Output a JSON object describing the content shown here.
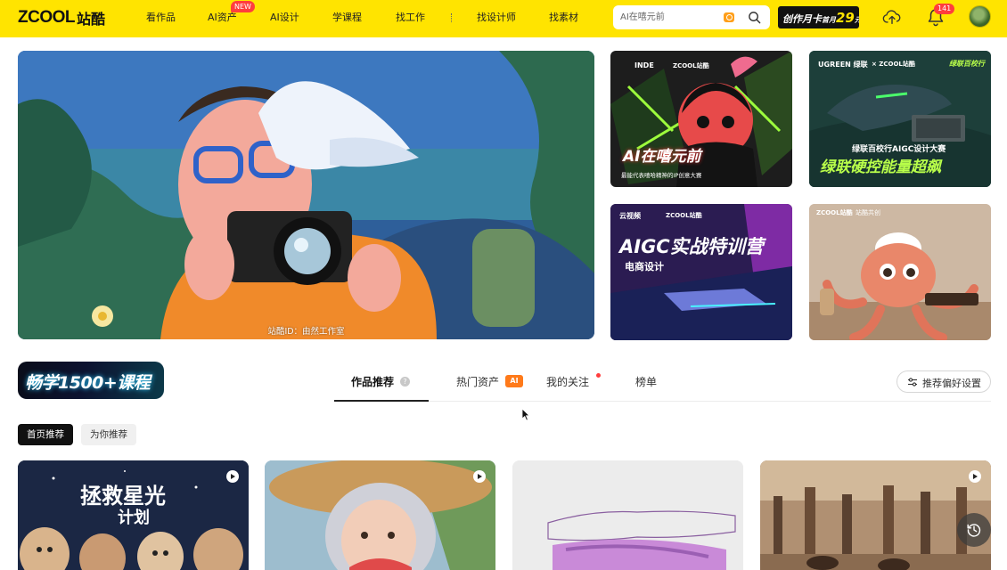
{
  "header": {
    "logo_text": "ZCOOL",
    "logo_cn": "站酷",
    "nav": [
      {
        "label": "看作品"
      },
      {
        "label": "AI资产",
        "badge": "NEW"
      },
      {
        "label": "AI设计"
      },
      {
        "label": "学课程"
      },
      {
        "label": "找工作"
      },
      {
        "label": "找设计师"
      },
      {
        "label": "找素材"
      }
    ],
    "search_placeholder": "AI在嘻元前",
    "promo": {
      "text": "创作月卡",
      "sub": "首月",
      "price": "29",
      "unit": "元"
    },
    "notification_count": "141",
    "icons": {
      "camera": "camera-icon",
      "search": "search-icon",
      "upload": "upload-cloud-icon",
      "bell": "bell-icon"
    }
  },
  "hero": {
    "caption": "站酷ID：由然工作室"
  },
  "tiles": [
    {
      "line1": "INDE",
      "line2": "ZCOOL站酷",
      "headline": "AI在嘻元前",
      "sub": "最能代表嘻哈精神的IP创意大赛"
    },
    {
      "line1": "UGREEN 绿联",
      "line2": "× ZCOOL站酷",
      "corner": "绿联百校行",
      "sub": "绿联百校行AIGC设计大赛",
      "headline": "绿联硬控能量超飙"
    },
    {
      "line1": "云视频",
      "line2": "ZCOOL站酷",
      "headline": "AIGC实战特训营",
      "sub": "电商设计"
    },
    {
      "line1": "ZCOOL站酷",
      "line2": "站酷共创"
    }
  ],
  "course_banner": "畅学1500+课程",
  "tabs": [
    {
      "label": "作品推荐",
      "active": true
    },
    {
      "label": "热门资产",
      "badge": "AI"
    },
    {
      "label": "我的关注"
    },
    {
      "label": "榜单"
    }
  ],
  "help_mark": "?",
  "pref_button": "推荐偏好设置",
  "pills": [
    "首页推荐",
    "为你推荐"
  ],
  "cards": [
    {
      "title": "拯救星光计划",
      "title_line1": "拯救星光",
      "title_line2": "计划",
      "video": true
    },
    {
      "video": true
    },
    {
      "video": false
    },
    {
      "video": true
    }
  ],
  "colors": {
    "brand_yellow": "#ffe400",
    "badge_red": "#ff3d3d",
    "ai_orange": "#ff7a1a"
  }
}
